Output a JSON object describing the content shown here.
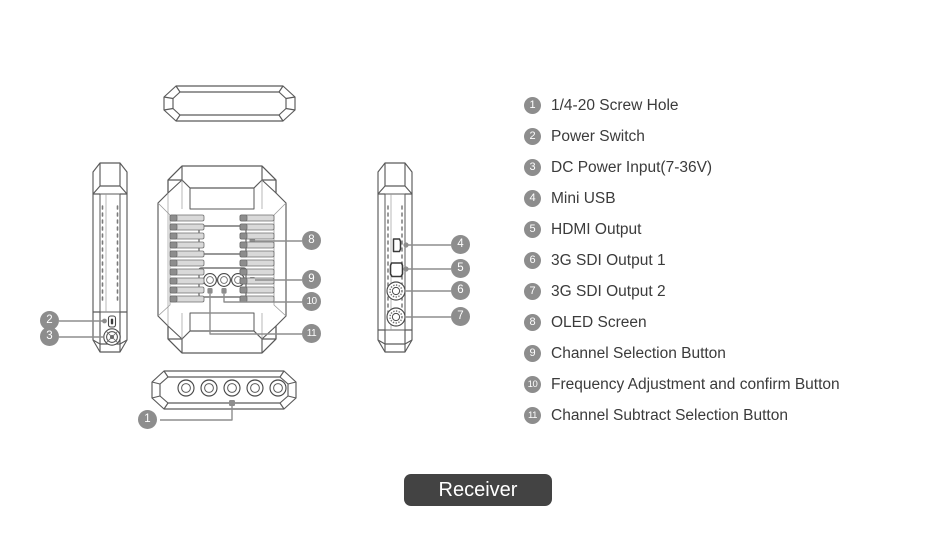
{
  "device": {
    "name": "Receiver",
    "views": [
      "top-view",
      "left-side-view",
      "back-view",
      "right-side-view",
      "bottom-view"
    ]
  },
  "label_pill": {
    "text": "Receiver"
  },
  "legend": {
    "items": [
      {
        "num": "1",
        "label": "1/4-20 Screw Hole"
      },
      {
        "num": "2",
        "label": "Power Switch"
      },
      {
        "num": "3",
        "label": "DC Power Input(7-36V)"
      },
      {
        "num": "4",
        "label": "Mini USB"
      },
      {
        "num": "5",
        "label": "HDMI Output"
      },
      {
        "num": "6",
        "label": "3G SDI Output 1"
      },
      {
        "num": "7",
        "label": "3G SDI Output 2"
      },
      {
        "num": "8",
        "label": "OLED Screen"
      },
      {
        "num": "9",
        "label": "Channel Selection Button"
      },
      {
        "num": "10",
        "label": "Frequency Adjustment and confirm Button"
      },
      {
        "num": "11",
        "label": "Channel Subtract Selection Button"
      }
    ]
  },
  "callouts": [
    {
      "num": "1",
      "target": "quarter-twenty-screw-hole"
    },
    {
      "num": "2",
      "target": "power-switch"
    },
    {
      "num": "3",
      "target": "dc-power-input"
    },
    {
      "num": "4",
      "target": "mini-usb-port"
    },
    {
      "num": "5",
      "target": "hdmi-port"
    },
    {
      "num": "6",
      "target": "sdi-output-1"
    },
    {
      "num": "7",
      "target": "sdi-output-2"
    },
    {
      "num": "8",
      "target": "oled-screen"
    },
    {
      "num": "9",
      "target": "channel-selection-button"
    },
    {
      "num": "10",
      "target": "frequency-adjustment-button"
    },
    {
      "num": "11",
      "target": "channel-subtract-button"
    }
  ],
  "colors": {
    "background": "#ffffff",
    "outline": "#5a5a5a",
    "badge": "#8d8d8d",
    "badge_text": "#ffffff",
    "text": "#3b3b3b",
    "pill_bg": "#434343",
    "pill_text": "#ffffff",
    "fin_fill": "#d9d9d9",
    "fin_cap": "#8d8d8d",
    "leader_line": "#8d8d8d"
  }
}
